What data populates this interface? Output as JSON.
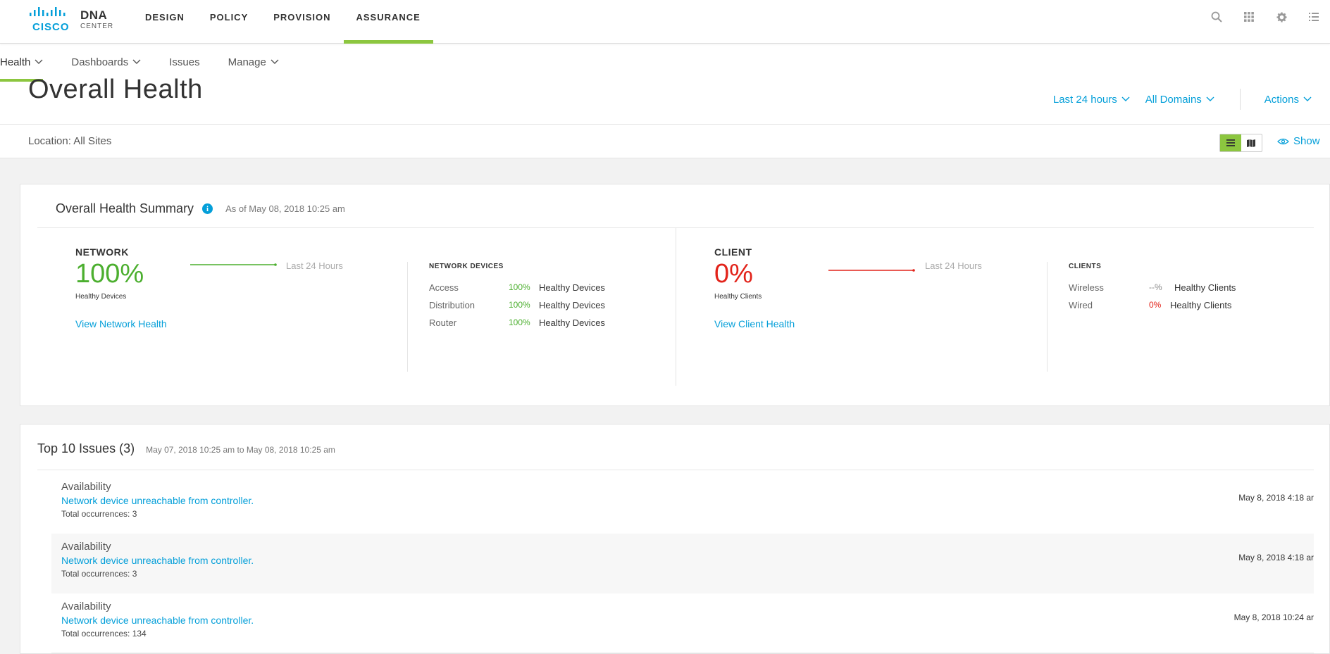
{
  "brand": {
    "company": "CISCO",
    "product": "DNA",
    "product_sub": "CENTER"
  },
  "top_nav": [
    "DESIGN",
    "POLICY",
    "PROVISION",
    "ASSURANCE"
  ],
  "top_nav_active": "ASSURANCE",
  "top_icons": [
    "search-icon",
    "apps-grid-icon",
    "gear-icon",
    "list-icon"
  ],
  "sub_nav": [
    {
      "label": "Health",
      "dropdown": true,
      "active": true
    },
    {
      "label": "Dashboards",
      "dropdown": true
    },
    {
      "label": "Issues",
      "dropdown": false
    },
    {
      "label": "Manage",
      "dropdown": true
    }
  ],
  "page_title": "Overall Health",
  "filters": {
    "time": "Last 24 hours",
    "domain": "All Domains",
    "actions": "Actions"
  },
  "location": {
    "label": "Location: All Sites",
    "show": "Show"
  },
  "summary": {
    "title": "Overall Health Summary",
    "as_of": "As of May 08, 2018 10:25 am",
    "network": {
      "heading": "NETWORK",
      "percent": "100%",
      "sub": "Healthy Devices",
      "trend_label": "Last 24 Hours",
      "link": "View Network Health",
      "devices_heading": "NETWORK DEVICES",
      "devices": [
        {
          "name": "Access",
          "value": "100%",
          "text": "Healthy Devices"
        },
        {
          "name": "Distribution",
          "value": "100%",
          "text": "Healthy Devices"
        },
        {
          "name": "Router",
          "value": "100%",
          "text": "Healthy Devices"
        }
      ]
    },
    "client": {
      "heading": "CLIENT",
      "percent": "0%",
      "sub": "Healthy Clients",
      "trend_label": "Last 24 Hours",
      "link": "View Client Health",
      "clients_heading": "CLIENTS",
      "clients": [
        {
          "name": "Wireless",
          "value": "--%",
          "text": "Healthy Clients"
        },
        {
          "name": "Wired",
          "value": "0%",
          "text": "Healthy Clients"
        }
      ]
    }
  },
  "issues": {
    "title": "Top 10 Issues (3)",
    "range": "May 07, 2018 10:25 am to May 08, 2018 10:25 am",
    "items": [
      {
        "category": "Availability",
        "description": "Network device unreachable from controller.",
        "occurrences": "Total occurrences: 3",
        "time": "May 8, 2018 4:18 ar"
      },
      {
        "category": "Availability",
        "description": "Network device unreachable from controller.",
        "occurrences": "Total occurrences: 3",
        "time": "May 8, 2018 4:18 ar"
      },
      {
        "category": "Availability",
        "description": "Network device unreachable from controller.",
        "occurrences": "Total occurrences: 134",
        "time": "May 8, 2018 10:24 ar"
      }
    ]
  },
  "colors": {
    "accent": "#049fd9",
    "green": "#8cc63f",
    "healthy": "#4caf2f",
    "critical": "#e2231a"
  }
}
